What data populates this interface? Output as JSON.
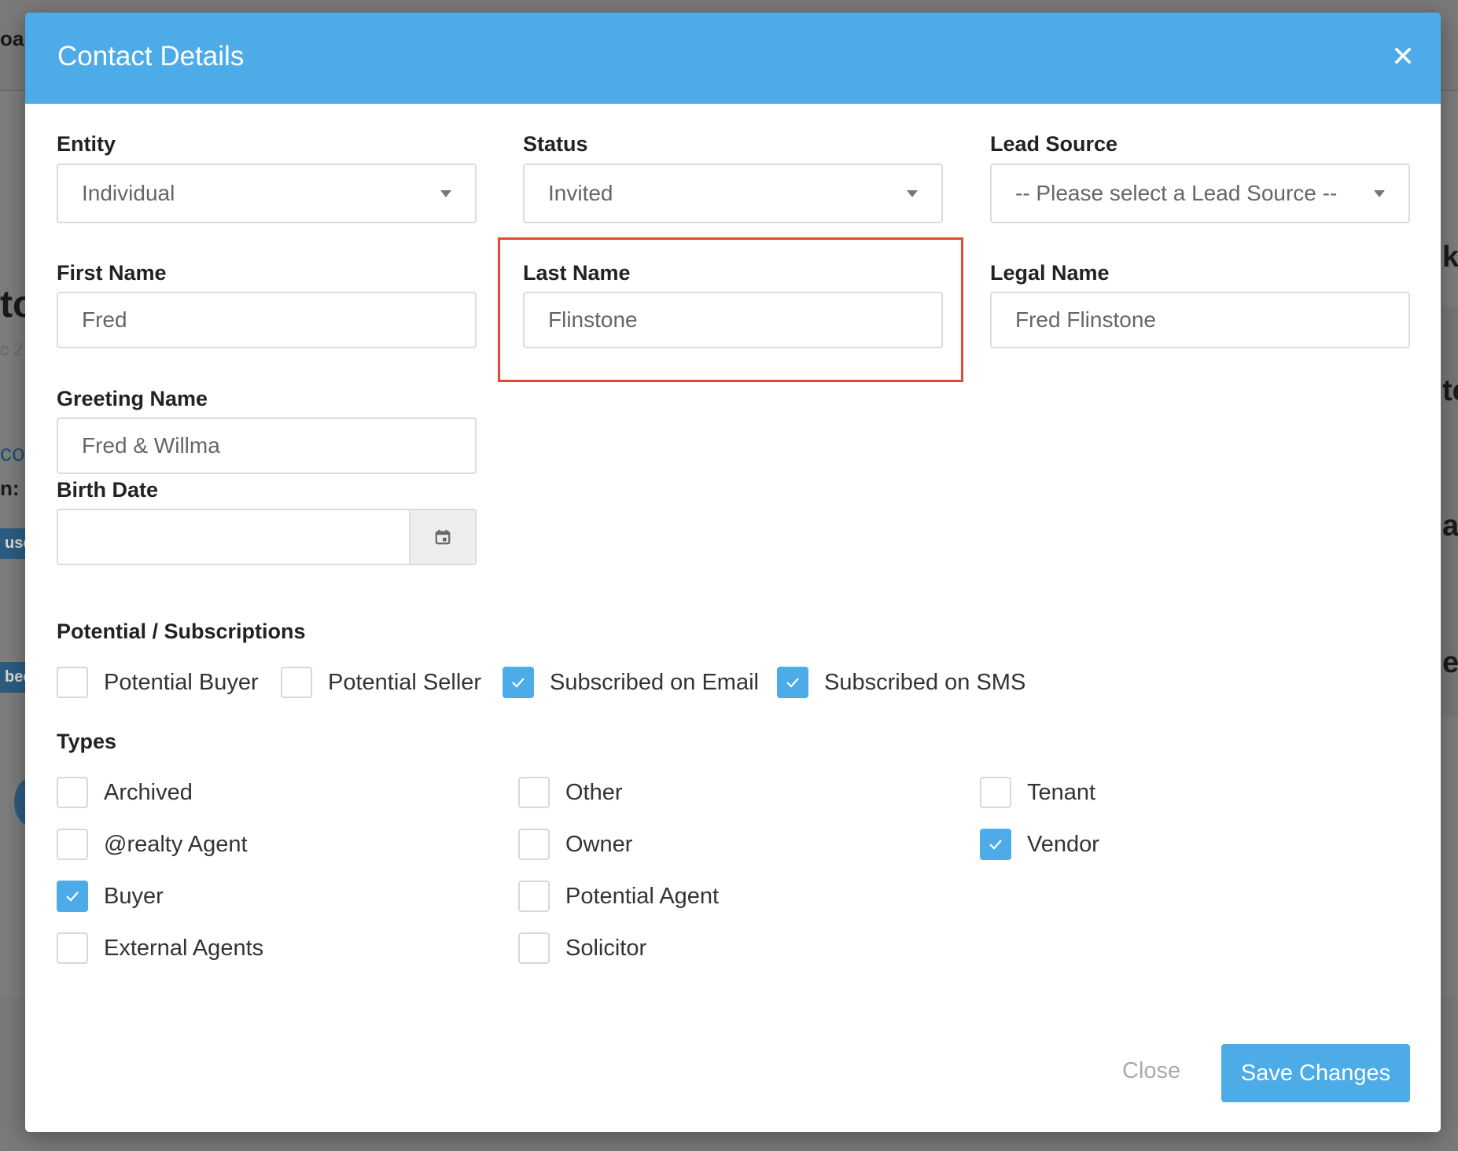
{
  "modal": {
    "title": "Contact Details",
    "close_icon": "close-icon"
  },
  "fields": {
    "entity": {
      "label": "Entity",
      "value": "Individual"
    },
    "status": {
      "label": "Status",
      "value": "Invited"
    },
    "lead_source": {
      "label": "Lead Source",
      "value": "-- Please select a Lead Source --"
    },
    "first_name": {
      "label": "First Name",
      "value": "Fred"
    },
    "last_name": {
      "label": "Last Name",
      "value": "Flinstone"
    },
    "legal_name": {
      "label": "Legal Name",
      "value": "Fred Flinstone"
    },
    "greeting_name": {
      "label": "Greeting Name",
      "value": "Fred & Willma"
    },
    "birth_date": {
      "label": "Birth Date",
      "value": ""
    }
  },
  "subscriptions": {
    "title": "Potential / Subscriptions",
    "items": [
      {
        "label": "Potential Buyer",
        "checked": false
      },
      {
        "label": "Potential Seller",
        "checked": false
      },
      {
        "label": "Subscribed on Email",
        "checked": true
      },
      {
        "label": "Subscribed on SMS",
        "checked": true
      }
    ]
  },
  "types": {
    "title": "Types",
    "items": [
      {
        "label": "Archived",
        "checked": false
      },
      {
        "label": "@realty Agent",
        "checked": false
      },
      {
        "label": "Buyer",
        "checked": true
      },
      {
        "label": "External Agents",
        "checked": false
      },
      {
        "label": "Other",
        "checked": false
      },
      {
        "label": "Owner",
        "checked": false
      },
      {
        "label": "Potential Agent",
        "checked": false
      },
      {
        "label": "Solicitor",
        "checked": false
      },
      {
        "label": "Tenant",
        "checked": false
      },
      {
        "label": "Vendor",
        "checked": true
      }
    ]
  },
  "footer": {
    "close_label": "Close",
    "save_label": "Save Changes"
  },
  "background": {
    "fragments": [
      "oa",
      "to",
      "c 2",
      "co",
      "n:",
      "use",
      "bee",
      "k",
      "te",
      "at",
      "ec"
    ]
  },
  "colors": {
    "accent": "#4dabe8",
    "highlight": "#e04a2f"
  }
}
